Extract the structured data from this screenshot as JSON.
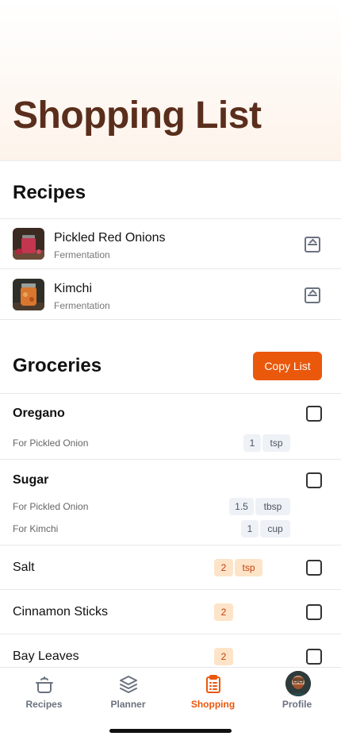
{
  "header": {
    "title": "Shopping List"
  },
  "recipes": {
    "title": "Recipes",
    "items": [
      {
        "name": "Pickled Red Onions",
        "category": "Fermentation"
      },
      {
        "name": "Kimchi",
        "category": "Fermentation"
      }
    ]
  },
  "groceries": {
    "title": "Groceries",
    "copy_label": "Copy List",
    "items": [
      {
        "name": "Oregano",
        "uses": [
          {
            "label": "For Pickled Onion",
            "qty": "1",
            "unit": "tsp"
          }
        ]
      },
      {
        "name": "Sugar",
        "uses": [
          {
            "label": "For Pickled Onion",
            "qty": "1.5",
            "unit": "tbsp"
          },
          {
            "label": "For Kimchi",
            "qty": "1",
            "unit": "cup"
          }
        ]
      },
      {
        "name": "Salt",
        "qty": "2",
        "unit": "tsp"
      },
      {
        "name": "Cinnamon Sticks",
        "qty": "2"
      },
      {
        "name": "Bay Leaves",
        "qty": "2"
      }
    ]
  },
  "tabs": [
    {
      "label": "Recipes",
      "icon": "pot-icon"
    },
    {
      "label": "Planner",
      "icon": "layers-icon"
    },
    {
      "label": "Shopping",
      "icon": "clipboard-list-icon",
      "active": true
    },
    {
      "label": "Profile",
      "icon": "avatar"
    }
  ],
  "colors": {
    "accent": "#ea580c",
    "title": "#5a2e1c",
    "header_bg": "#fdf3ea"
  }
}
